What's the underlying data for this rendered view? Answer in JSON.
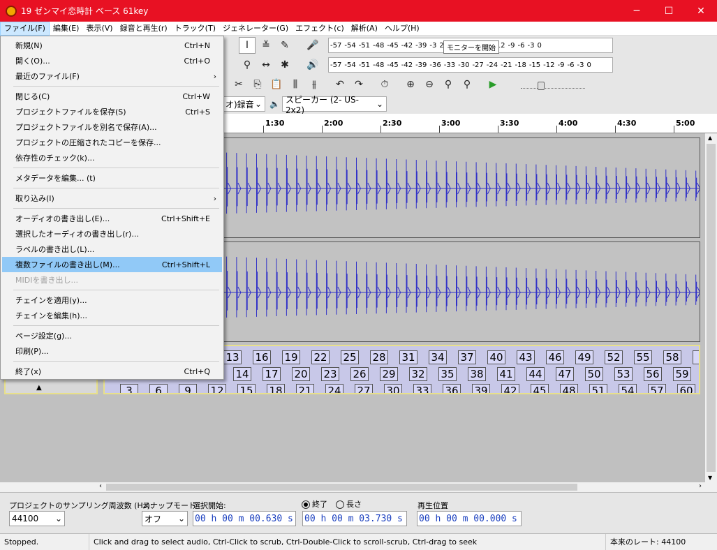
{
  "window": {
    "title": "19 ゼンマイ恋時計 ベース 61key",
    "minimize": "─",
    "maximize": "☐",
    "close": "✕"
  },
  "menubar": [
    {
      "label": "ファイル(F)",
      "active": true
    },
    {
      "label": "編集(E)"
    },
    {
      "label": "表示(V)"
    },
    {
      "label": "録音と再生(r)"
    },
    {
      "label": "トラック(T)"
    },
    {
      "label": "ジェネレーター(G)"
    },
    {
      "label": "エフェクト(c)"
    },
    {
      "label": "解析(A)"
    },
    {
      "label": "ヘルプ(H)"
    }
  ],
  "file_menu": {
    "items": [
      {
        "label": "新規(N)",
        "shortcut": "Ctrl+N"
      },
      {
        "label": "開く(O)...",
        "shortcut": "Ctrl+O"
      },
      {
        "label": "最近のファイル(F)",
        "submenu": true
      },
      {
        "sep": true
      },
      {
        "label": "閉じる(C)",
        "shortcut": "Ctrl+W"
      },
      {
        "label": "プロジェクトファイルを保存(S)",
        "shortcut": "Ctrl+S"
      },
      {
        "label": "プロジェクトファイルを別名で保存(A)...",
        "shortcut": ""
      },
      {
        "label": "プロジェクトの圧縮されたコピーを保存...",
        "shortcut": ""
      },
      {
        "label": "依存性のチェック(k)...",
        "shortcut": ""
      },
      {
        "sep": true
      },
      {
        "label": "メタデータを編集... (t)",
        "shortcut": ""
      },
      {
        "sep": true
      },
      {
        "label": "取り込み(I)",
        "submenu": true
      },
      {
        "sep": true
      },
      {
        "label": "オーディオの書き出し(E)...",
        "shortcut": "Ctrl+Shift+E"
      },
      {
        "label": "選択したオーディオの書き出し(r)...",
        "shortcut": ""
      },
      {
        "label": "ラベルの書き出し(L)...",
        "shortcut": ""
      },
      {
        "label": "複数ファイルの書き出し(M)...",
        "shortcut": "Ctrl+Shift+L",
        "highlighted": true
      },
      {
        "label": "MIDIを書き出し...",
        "shortcut": "",
        "disabled": true
      },
      {
        "sep": true
      },
      {
        "label": "チェインを適用(y)...",
        "shortcut": ""
      },
      {
        "label": "チェインを編集(h)...",
        "shortcut": ""
      },
      {
        "sep": true
      },
      {
        "label": "ページ設定(g)...",
        "shortcut": ""
      },
      {
        "label": "印刷(P)...",
        "shortcut": ""
      },
      {
        "sep": true
      },
      {
        "label": "終了(x)",
        "shortcut": "Ctrl+Q"
      }
    ]
  },
  "meters": {
    "record_scale": [
      "-57",
      "-54",
      "-51",
      "-48",
      "-45",
      "-42",
      "-39",
      "-3",
      "24",
      "-21",
      "-18",
      "-15",
      "-12",
      "-9",
      "-6",
      "-3",
      "0"
    ],
    "play_scale": [
      "-57",
      "-54",
      "-51",
      "-48",
      "-45",
      "-42",
      "-39",
      "-36",
      "-33",
      "-30",
      "-27",
      "-24",
      "-21",
      "-18",
      "-15",
      "-12",
      "-9",
      "-6",
      "-3",
      "0"
    ],
    "monitor_tip": "モニターを開始",
    "lr": "L R"
  },
  "devices": {
    "record_channels": "オ)録音",
    "speaker": "スピーカー (2- US-2x2)"
  },
  "ruler": {
    "ticks": [
      "1:30",
      "2:00",
      "2:30",
      "3:00",
      "3:30",
      "4:00",
      "4:30",
      "5:00"
    ]
  },
  "labels": {
    "row1": [
      "13",
      "16",
      "19",
      "22",
      "25",
      "28",
      "31",
      "34",
      "37",
      "40",
      "43",
      "46",
      "49",
      "52",
      "55",
      "58",
      "6"
    ],
    "row2": [
      "14",
      "17",
      "20",
      "23",
      "26",
      "29",
      "32",
      "35",
      "38",
      "41",
      "44",
      "47",
      "50",
      "53",
      "56",
      "59"
    ],
    "row3": [
      "3",
      "6",
      "9",
      "12",
      "15",
      "18",
      "21",
      "24",
      "27",
      "30",
      "33",
      "36",
      "39",
      "42",
      "45",
      "48",
      "51",
      "54",
      "57",
      "60"
    ]
  },
  "selection_bar": {
    "rate_label": "プロジェクトのサンプリング周波数 (Hz):",
    "rate_value": "44100",
    "snap_label": "スナップモード",
    "snap_value": "オフ",
    "sel_start_label": "選択開始:",
    "end_label": "終了",
    "length_label": "長さ",
    "start_time": "00 h 00 m 00.630 s",
    "end_time": "00 h 00 m 03.730 s",
    "playpos_label": "再生位置",
    "playpos_time": "00 h 00 m 00.000 s"
  },
  "status": {
    "state": "Stopped.",
    "hint": "Click and drag to select audio, Ctrl-Click to scrub, Ctrl-Double-Click to scroll-scrub, Ctrl-drag to seek",
    "rate": "本来のレート: 44100"
  },
  "colors": {
    "titlebar": "#e81123",
    "waveform": "#3232c8",
    "highlight": "#91c9f7"
  }
}
